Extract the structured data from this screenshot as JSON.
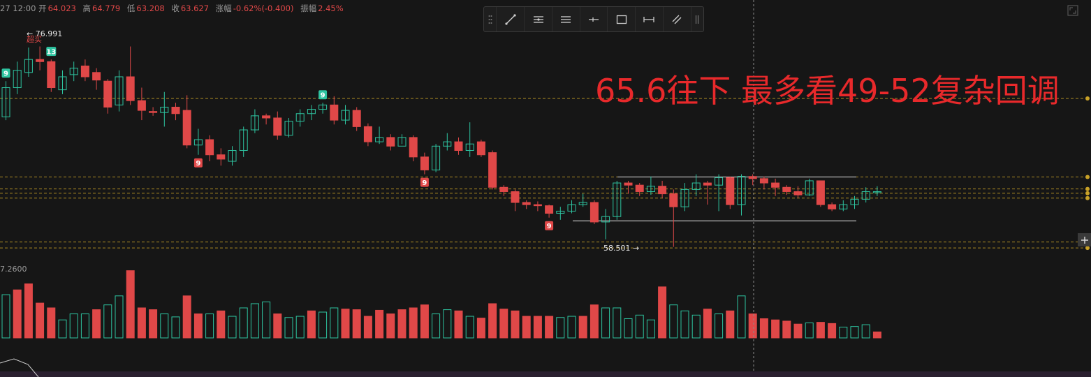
{
  "header": {
    "time": "27 12:00",
    "open_label": "开",
    "open_value": "64.023",
    "high_label": "高",
    "high_value": "64.779",
    "low_label": "低",
    "low_value": "63.208",
    "close_label": "收",
    "close_value": "63.627",
    "change_label": "涨幅",
    "change_value": "-0.62%(-0.400)",
    "amplitude_label": "振幅",
    "amplitude_value": "2.45%"
  },
  "toolbar": {
    "tools": [
      "trend-line-icon",
      "parallel-channel-icon",
      "horizontal-lines-icon",
      "horizontal-ray-icon",
      "rectangle-icon",
      "price-range-icon",
      "parallel-lines-icon"
    ]
  },
  "annotation": {
    "text": "65.6往下 最多看49-52复杂回调",
    "color": "#e8292b"
  },
  "colors": {
    "up": "#2ec4a0",
    "down": "#e04848",
    "level": "#c9a227",
    "background": "#161616"
  },
  "chart_data": {
    "type": "candlestick",
    "price_range": [
      56.8,
      80.0
    ],
    "volume_scale_label": "7.2600",
    "high_marker": "← 76.991",
    "high_marker_note": "超买",
    "low_marker": "58.501 →",
    "levels": [
      72.2,
      64.95,
      63.85,
      63.45,
      63.0,
      58.95,
      58.4
    ],
    "range_box": {
      "top": 64.95,
      "bottom": 60.9
    },
    "candles": [
      [
        70.5,
        73.2,
        70.2,
        73.8
      ],
      [
        73.2,
        74.8,
        72.6,
        75.6
      ],
      [
        74.6,
        75.8,
        74.2,
        76.9
      ],
      [
        75.8,
        75.6,
        74.8,
        77.0
      ],
      [
        75.6,
        73.2,
        72.8,
        75.8
      ],
      [
        73.0,
        74.2,
        72.6,
        74.8
      ],
      [
        74.4,
        75.0,
        73.8,
        75.6
      ],
      [
        75.2,
        74.2,
        73.8,
        75.8
      ],
      [
        74.6,
        73.9,
        73.0,
        75.0
      ],
      [
        73.8,
        71.4,
        70.8,
        74.0
      ],
      [
        71.6,
        74.2,
        71.0,
        74.8
      ],
      [
        74.2,
        72.0,
        71.6,
        77.0
      ],
      [
        72.0,
        71.1,
        70.2,
        73.2
      ],
      [
        71.0,
        70.9,
        70.6,
        71.4
      ],
      [
        70.9,
        71.4,
        69.6,
        72.8
      ],
      [
        71.4,
        70.8,
        70.2,
        71.8
      ],
      [
        71.1,
        67.9,
        67.6,
        72.5
      ],
      [
        67.9,
        68.4,
        67.0,
        69.4
      ],
      [
        68.4,
        67.0,
        66.4,
        68.8
      ],
      [
        67.0,
        66.6,
        66.0,
        67.6
      ],
      [
        66.4,
        67.4,
        66.0,
        67.8
      ],
      [
        67.4,
        69.3,
        66.8,
        69.6
      ],
      [
        69.3,
        70.6,
        69.0,
        71.2
      ],
      [
        70.6,
        70.4,
        69.8,
        70.8
      ],
      [
        70.4,
        68.8,
        68.4,
        71.0
      ],
      [
        68.8,
        70.1,
        68.6,
        70.4
      ],
      [
        70.1,
        70.8,
        69.6,
        71.2
      ],
      [
        70.8,
        71.2,
        70.2,
        71.6
      ],
      [
        71.2,
        71.6,
        70.8,
        71.8
      ],
      [
        71.6,
        70.2,
        69.8,
        72.4
      ],
      [
        70.2,
        71.1,
        69.8,
        71.6
      ],
      [
        71.1,
        69.6,
        69.2,
        71.4
      ],
      [
        69.6,
        68.2,
        67.8,
        69.9
      ],
      [
        68.2,
        68.6,
        68.0,
        69.6
      ],
      [
        68.6,
        67.8,
        67.4,
        68.9
      ],
      [
        67.8,
        68.6,
        68.0,
        68.9
      ],
      [
        68.6,
        66.8,
        66.4,
        68.8
      ],
      [
        66.8,
        65.6,
        65.2,
        67.2
      ],
      [
        65.6,
        67.8,
        65.4,
        68.0
      ],
      [
        67.8,
        68.2,
        67.4,
        69.0
      ],
      [
        68.2,
        67.4,
        67.0,
        68.6
      ],
      [
        67.4,
        68.0,
        66.8,
        70.0
      ],
      [
        68.2,
        67.0,
        66.8,
        68.4
      ],
      [
        67.2,
        64.0,
        63.8,
        67.4
      ],
      [
        64.0,
        63.6,
        63.2,
        64.2
      ],
      [
        63.6,
        62.6,
        61.8,
        63.8
      ],
      [
        62.6,
        62.4,
        62.0,
        62.8
      ],
      [
        62.4,
        62.3,
        61.8,
        62.7
      ],
      [
        62.3,
        61.6,
        61.2,
        62.4
      ],
      [
        61.6,
        61.8,
        61.0,
        62.2
      ],
      [
        61.8,
        62.4,
        61.6,
        62.8
      ],
      [
        62.4,
        62.6,
        62.2,
        63.4
      ],
      [
        62.6,
        60.8,
        60.6,
        62.8
      ],
      [
        60.8,
        61.3,
        59.2,
        62.0
      ],
      [
        61.3,
        64.4,
        61.0,
        64.6
      ],
      [
        64.4,
        64.2,
        63.4,
        64.6
      ],
      [
        64.2,
        63.6,
        63.2,
        64.4
      ],
      [
        63.6,
        64.1,
        63.3,
        65.0
      ],
      [
        64.1,
        63.4,
        63.0,
        64.6
      ],
      [
        63.4,
        62.2,
        58.5,
        63.8
      ],
      [
        62.2,
        63.8,
        61.8,
        64.4
      ],
      [
        63.8,
        64.4,
        63.2,
        65.2
      ],
      [
        64.4,
        64.2,
        62.4,
        64.6
      ],
      [
        64.2,
        64.9,
        61.8,
        65.2
      ],
      [
        64.9,
        62.4,
        62.0,
        65.0
      ],
      [
        62.4,
        65.0,
        61.4,
        65.2
      ],
      [
        65.0,
        64.8,
        64.2,
        65.2
      ],
      [
        64.8,
        64.4,
        63.8,
        65.0
      ],
      [
        64.4,
        64.0,
        63.2,
        64.8
      ],
      [
        64.0,
        63.6,
        63.3,
        64.2
      ],
      [
        63.6,
        63.3,
        63.0,
        64.1
      ],
      [
        63.3,
        64.6,
        63.2,
        64.8
      ],
      [
        64.6,
        62.4,
        62.2,
        64.6
      ],
      [
        62.4,
        62.0,
        61.8,
        62.6
      ],
      [
        62.0,
        62.4,
        61.8,
        62.8
      ],
      [
        62.4,
        62.9,
        62.0,
        63.2
      ],
      [
        62.9,
        63.6,
        62.6,
        64.0
      ],
      [
        63.6,
        63.6,
        63.2,
        64.1
      ]
    ],
    "volumes": [
      [
        0.72,
        "up"
      ],
      [
        0.8,
        "down"
      ],
      [
        0.9,
        "down"
      ],
      [
        0.58,
        "down"
      ],
      [
        0.5,
        "down"
      ],
      [
        0.3,
        "up"
      ],
      [
        0.4,
        "up"
      ],
      [
        0.4,
        "up"
      ],
      [
        0.47,
        "down"
      ],
      [
        0.55,
        "up"
      ],
      [
        0.7,
        "up"
      ],
      [
        1.12,
        "down"
      ],
      [
        0.5,
        "down"
      ],
      [
        0.47,
        "down"
      ],
      [
        0.4,
        "up"
      ],
      [
        0.35,
        "up"
      ],
      [
        0.7,
        "down"
      ],
      [
        0.4,
        "down"
      ],
      [
        0.4,
        "up"
      ],
      [
        0.45,
        "down"
      ],
      [
        0.36,
        "up"
      ],
      [
        0.5,
        "up"
      ],
      [
        0.57,
        "up"
      ],
      [
        0.6,
        "up"
      ],
      [
        0.4,
        "down"
      ],
      [
        0.34,
        "up"
      ],
      [
        0.36,
        "up"
      ],
      [
        0.45,
        "down"
      ],
      [
        0.43,
        "up"
      ],
      [
        0.5,
        "up"
      ],
      [
        0.48,
        "down"
      ],
      [
        0.47,
        "down"
      ],
      [
        0.36,
        "down"
      ],
      [
        0.46,
        "down"
      ],
      [
        0.4,
        "down"
      ],
      [
        0.47,
        "down"
      ],
      [
        0.5,
        "down"
      ],
      [
        0.55,
        "down"
      ],
      [
        0.4,
        "up"
      ],
      [
        0.47,
        "up"
      ],
      [
        0.45,
        "down"
      ],
      [
        0.36,
        "up"
      ],
      [
        0.33,
        "down"
      ],
      [
        0.57,
        "down"
      ],
      [
        0.48,
        "down"
      ],
      [
        0.45,
        "down"
      ],
      [
        0.36,
        "down"
      ],
      [
        0.36,
        "down"
      ],
      [
        0.36,
        "down"
      ],
      [
        0.34,
        "up"
      ],
      [
        0.36,
        "up"
      ],
      [
        0.36,
        "down"
      ],
      [
        0.55,
        "down"
      ],
      [
        0.5,
        "up"
      ],
      [
        0.5,
        "up"
      ],
      [
        0.32,
        "up"
      ],
      [
        0.38,
        "up"
      ],
      [
        0.3,
        "up"
      ],
      [
        0.85,
        "down"
      ],
      [
        0.55,
        "up"
      ],
      [
        0.45,
        "up"
      ],
      [
        0.38,
        "up"
      ],
      [
        0.48,
        "down"
      ],
      [
        0.4,
        "up"
      ],
      [
        0.45,
        "down"
      ],
      [
        0.7,
        "up"
      ],
      [
        0.4,
        "down"
      ],
      [
        0.32,
        "down"
      ],
      [
        0.3,
        "down"
      ],
      [
        0.28,
        "down"
      ],
      [
        0.23,
        "down"
      ],
      [
        0.25,
        "up"
      ],
      [
        0.26,
        "down"
      ],
      [
        0.24,
        "down"
      ],
      [
        0.18,
        "up"
      ],
      [
        0.19,
        "up"
      ],
      [
        0.22,
        "up"
      ],
      [
        0.1,
        "down"
      ]
    ],
    "td_marks": [
      {
        "index": 0,
        "label": "9",
        "kind": "up"
      },
      {
        "index": 4,
        "label": "13",
        "kind": "up"
      },
      {
        "index": 17,
        "label": "9",
        "kind": "down"
      },
      {
        "index": 28,
        "label": "9",
        "kind": "up"
      },
      {
        "index": 37,
        "label": "9",
        "kind": "down"
      },
      {
        "index": 48,
        "label": "9",
        "kind": "down"
      }
    ]
  }
}
